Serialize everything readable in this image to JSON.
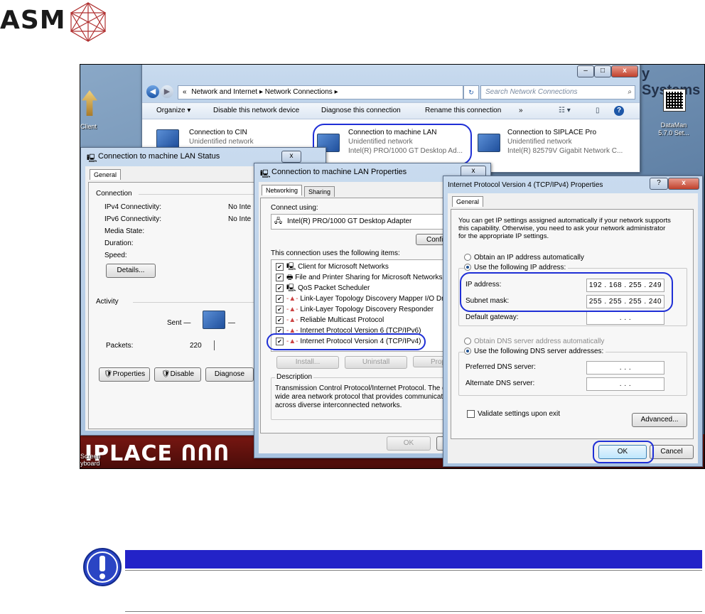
{
  "logo": {
    "text": "ASM"
  },
  "desktop": {
    "left_icon_label": "Client",
    "right_icon_label_1": "DataMan",
    "right_icon_label_2": "5.7.0 Set...",
    "systems_text": "y Systems",
    "siplace_text": "IPLACE ՈՈՈ",
    "screen_label_1": "Screen",
    "screen_label_2": "yboard"
  },
  "explorer": {
    "address": {
      "arrow_prefix": "«",
      "crumb_1": "Network and Internet",
      "crumb_2": "Network Connections",
      "search_placeholder": "Search Network Connections"
    },
    "toolbar": {
      "organize": "Organize ▾",
      "disable": "Disable this network device",
      "diagnose": "Diagnose this connection",
      "rename": "Rename this connection",
      "more": "»"
    },
    "connections": [
      {
        "name": "Connection to CIN",
        "status": "Unidentified network",
        "adapter": ""
      },
      {
        "name": "Connection to machine LAN",
        "status": "Unidentified network",
        "adapter": "Intel(R) PRO/1000 GT Desktop Ad..."
      },
      {
        "name": "Connection to SIPLACE Pro",
        "status": "Unidentified network",
        "adapter": "Intel(R) 82579V Gigabit Network C..."
      }
    ]
  },
  "status_dialog": {
    "title": "Connection to machine LAN Status",
    "tab": "General",
    "connection_label": "Connection",
    "rows": [
      {
        "label": "IPv4 Connectivity:",
        "value": "No Inte"
      },
      {
        "label": "IPv6 Connectivity:",
        "value": "No Inte"
      },
      {
        "label": "Media State:",
        "value": ""
      },
      {
        "label": "Duration:",
        "value": ""
      },
      {
        "label": "Speed:",
        "value": ""
      }
    ],
    "details_button": "Details...",
    "activity_label": "Activity",
    "sent_label": "Sent —",
    "packets_label": "Packets:",
    "packets_value": "220",
    "properties_button": "Properties",
    "disable_button": "Disable",
    "diagnose_button": "Diagnose"
  },
  "properties_dialog": {
    "title": "Connection to machine LAN Properties",
    "tabs": [
      "Networking",
      "Sharing"
    ],
    "connect_using_label": "Connect using:",
    "adapter": "Intel(R) PRO/1000 GT Desktop Adapter",
    "configure_button": "Configu",
    "items_label": "This connection uses the following items:",
    "items": [
      "Client for Microsoft Networks",
      "File and Printer Sharing for Microsoft Networks",
      "QoS Packet Scheduler",
      "Link-Layer Topology Discovery Mapper I/O Drive",
      "Link-Layer Topology Discovery Responder",
      "Reliable Multicast Protocol",
      "Internet Protocol Version 6 (TCP/IPv6)",
      "Internet Protocol Version 4 (TCP/IPv4)"
    ],
    "install_button": "Install...",
    "uninstall_button": "Uninstall",
    "properties_button": "Prope",
    "description_label": "Description",
    "description_lines": [
      "Transmission Control Protocol/Internet Protocol. The de",
      "wide area network protocol that provides communicatio",
      "across diverse interconnected networks."
    ],
    "ok_button": "OK"
  },
  "ipv4_dialog": {
    "title": "Internet Protocol Version 4 (TCP/IPv4) Properties",
    "tab": "General",
    "intro_lines": [
      "You can get IP settings assigned automatically if your network supports",
      "this capability. Otherwise, you need to ask your network administrator",
      "for the appropriate IP settings."
    ],
    "obtain_ip_auto": "Obtain an IP address automatically",
    "use_following_ip": "Use the following IP address:",
    "ip_address_label": "IP address:",
    "ip_address_value": "192 . 168 . 255 . 249",
    "subnet_label": "Subnet mask:",
    "subnet_value": "255 . 255 . 255 . 240",
    "gateway_label": "Default gateway:",
    "gateway_value": ".      .      .",
    "obtain_dns_auto": "Obtain DNS server address automatically",
    "use_following_dns": "Use the following DNS server addresses:",
    "preferred_dns_label": "Preferred DNS server:",
    "preferred_dns_value": ".      .      .",
    "alternate_dns_label": "Alternate DNS server:",
    "alternate_dns_value": ".      .      .",
    "validate_label": "Validate settings upon exit",
    "advanced_button": "Advanced...",
    "ok_button": "OK",
    "cancel_button": "Cancel"
  },
  "colors": {
    "highlight_oval": "#1f2fd6",
    "warning_bar": "#2323c8"
  }
}
